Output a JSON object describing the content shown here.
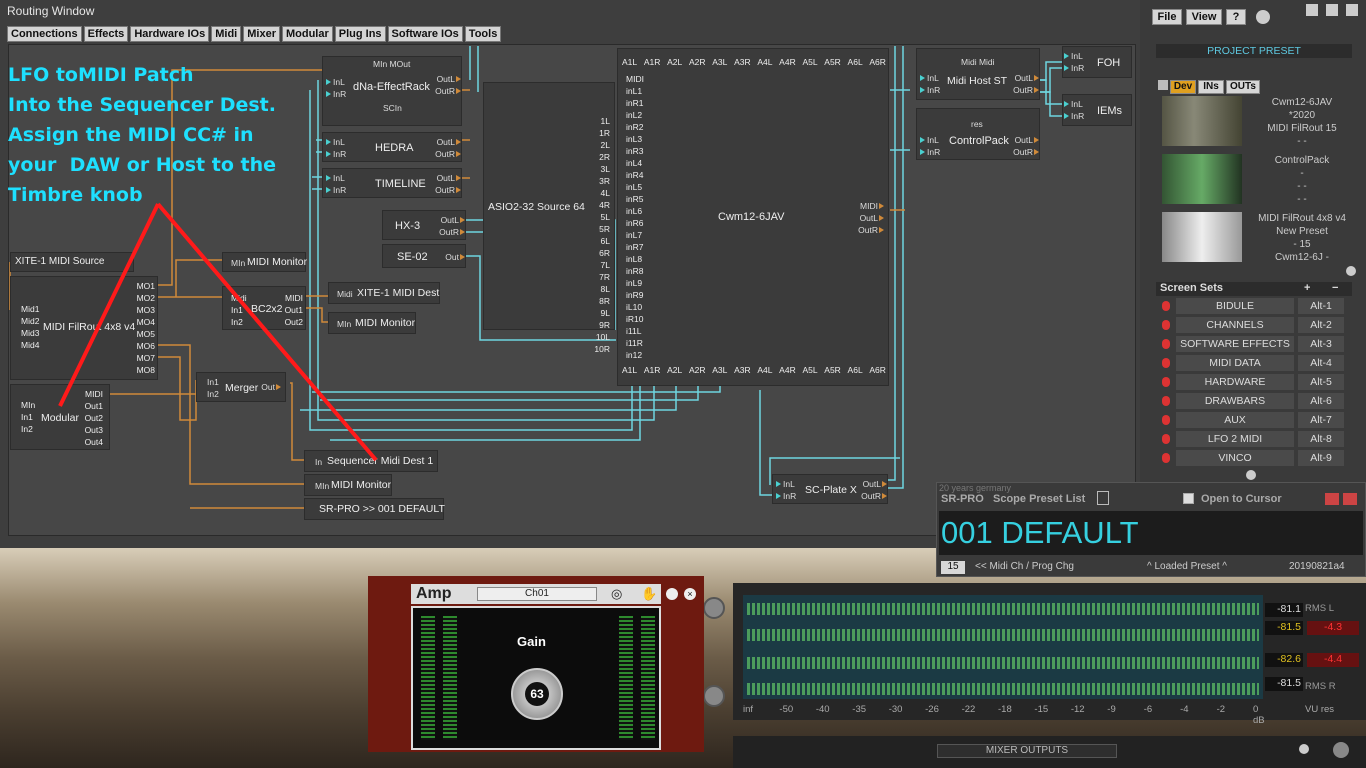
{
  "window": {
    "title": "Routing Window"
  },
  "menu": [
    "Connections",
    "Effects",
    "Hardware IOs",
    "Midi",
    "Mixer",
    "Modular",
    "Plug Ins",
    "Software IOs",
    "Tools"
  ],
  "note": "LFO toMIDI Patch\nInto the Sequencer Dest.\nAssign the MIDI CC# in\nyour  DAW or Host to the\nTimbre knob",
  "modules": {
    "dna": {
      "name": "dNa-EffectRack",
      "top": "MIn MOut",
      "inL": "InL",
      "inR": "InR",
      "outL": "OutL",
      "outR": "OutR",
      "scin": "SCIn"
    },
    "hedra": {
      "name": "HEDRA",
      "inL": "InL",
      "inR": "InR",
      "outL": "OutL",
      "outR": "OutR"
    },
    "timeline": {
      "name": "TIMELINE",
      "inL": "InL",
      "inR": "InR",
      "outL": "OutL",
      "outR": "OutR"
    },
    "hx3": {
      "name": "HX-3",
      "outL": "OutL",
      "outR": "OutR"
    },
    "se02": {
      "name": "SE-02",
      "out": "Out"
    },
    "asio": {
      "name": "ASIO2-32 Source 64",
      "outs": [
        "1L",
        "1R",
        "2L",
        "2R",
        "3L",
        "3R",
        "4L",
        "4R",
        "5L",
        "5R",
        "6L",
        "6R",
        "7L",
        "7R",
        "8L",
        "8R",
        "9L",
        "9R",
        "10L",
        "10R"
      ]
    },
    "cwm": {
      "name": "Cwm12-6JAV",
      "top": [
        "A1L",
        "A1R",
        "A2L",
        "A2R",
        "A3L",
        "A3R",
        "A4L",
        "A4R",
        "A5L",
        "A5R",
        "A6L",
        "A6R"
      ],
      "ins": [
        "MIDI",
        "inL1",
        "inR1",
        "inL2",
        "inR2",
        "inL3",
        "inR3",
        "inL4",
        "inR4",
        "inL5",
        "inR5",
        "inL6",
        "inR6",
        "inL7",
        "inR7",
        "inL8",
        "inR8",
        "inL9",
        "inR9",
        "iL10",
        "iR10",
        "i11L",
        "i11R",
        "in12"
      ],
      "outs": [
        "MIDI",
        "OutL",
        "OutR"
      ]
    },
    "hostst": {
      "name": "Midi Host ST",
      "top": "Midi  Midi",
      "inL": "InL",
      "inR": "InR",
      "outL": "OutL",
      "outR": "OutR"
    },
    "foh": {
      "name": "FOH",
      "inL": "InL",
      "inR": "InR"
    },
    "iems": {
      "name": "IEMs",
      "inL": "InL",
      "inR": "InR"
    },
    "controlpack": {
      "name": "ControlPack",
      "top": "res",
      "inL": "InL",
      "inR": "InR",
      "outL": "OutL",
      "outR": "OutR"
    },
    "xite_src": {
      "name": "XITE-1 MIDI Source"
    },
    "filrout": {
      "name": "MIDI FilRout 4x8 v4",
      "ins": [
        "Mid1",
        "Mid2",
        "Mid3",
        "Mid4"
      ],
      "outs": [
        "MO1",
        "MO2",
        "MO3",
        "MO4",
        "MO5",
        "MO6",
        "MO7",
        "MO8"
      ]
    },
    "modular": {
      "name": "Modular",
      "ins": [
        "MIn",
        "In1",
        "In2"
      ],
      "outs": [
        "MIDI",
        "Out1",
        "Out2",
        "Out3",
        "Out4"
      ]
    },
    "midimon1": {
      "name": "MIDI Monitor",
      "in": "MIn"
    },
    "bc2x2": {
      "name": "BC2x2",
      "ins": [
        "Midi",
        "In1",
        "In2"
      ],
      "outs": [
        "MIDI",
        "Out1",
        "Out2"
      ]
    },
    "xite_dest": {
      "name": "XITE-1 MIDI Dest",
      "in": "Midi"
    },
    "midimon2": {
      "name": "MIDI Monitor",
      "in": "MIn"
    },
    "merger": {
      "name": "Merger",
      "ins": [
        "In1",
        "In2"
      ],
      "out": "Out"
    },
    "seqdest": {
      "name": "Sequencer Midi Dest 1",
      "in": "In"
    },
    "midimon3": {
      "name": "MIDI Monitor",
      "in": "MIn"
    },
    "srpro_mod": {
      "name": "SR-PRO >> 001 DEFAULT"
    },
    "scplate": {
      "name": "SC-Plate X",
      "inL": "InL",
      "inR": "InR",
      "outL": "OutL",
      "outR": "OutR"
    }
  },
  "right_panel": {
    "file": "File",
    "view": "View",
    "help": "?",
    "project_preset": "PROJECT PRESET",
    "tabs": [
      "Dev",
      "INs",
      "OUTs"
    ],
    "devices": [
      {
        "lines": [
          "Cwm12-6JAV",
          "*2020",
          "MIDI FilRout   15",
          "-       -"
        ]
      },
      {
        "lines": [
          "ControlPack",
          "-",
          "-       -",
          "-       -"
        ]
      },
      {
        "lines": [
          "MIDI FilRout 4x8 v4",
          "New Preset",
          "-      15",
          "Cwm12-6J  -"
        ]
      }
    ],
    "screen_sets_title": "Screen Sets",
    "screen_sets": [
      {
        "name": "BIDULE",
        "key": "Alt-1"
      },
      {
        "name": "CHANNELS",
        "key": "Alt-2"
      },
      {
        "name": "SOFTWARE EFFECTS",
        "key": "Alt-3"
      },
      {
        "name": "MIDI DATA",
        "key": "Alt-4"
      },
      {
        "name": "HARDWARE",
        "key": "Alt-5"
      },
      {
        "name": "DRAWBARS",
        "key": "Alt-6"
      },
      {
        "name": "AUX",
        "key": "Alt-7"
      },
      {
        "name": "LFO 2 MIDI",
        "key": "Alt-8"
      },
      {
        "name": "VINCO",
        "key": "Alt-9"
      }
    ]
  },
  "srpro": {
    "brand": "20 years germany",
    "title": "SR-PRO",
    "list": "Scope Preset List",
    "open": "Open to Cursor",
    "preset": "001 DEFAULT",
    "ch": "15",
    "midi": "<< Midi Ch / Prog Chg",
    "loaded": "^ Loaded Preset ^",
    "date": "20190821a4"
  },
  "amp": {
    "title": "Amp",
    "channel": "Ch01",
    "gain_label": "Gain",
    "gain_value": "63"
  },
  "meter": {
    "l1": "-81.1",
    "l2": "-81.5",
    "r1": "-4.3",
    "l3": "-82.6",
    "r2": "-4.4",
    "l4": "-81.5",
    "rmsl": "RMS L",
    "rmsr": "RMS R",
    "scale": [
      "inf",
      "-50",
      "-40",
      "-35",
      "-30",
      "-26",
      "-22",
      "-18",
      "-15",
      "-12",
      "-9",
      "-6",
      "-4",
      "-2",
      "0 dB"
    ],
    "vu": "VU res"
  },
  "bottom": {
    "label": "MIXER OUTPUTS"
  },
  "colors": {
    "note": "#1ee0ff",
    "wire_orange": "#d08a3a",
    "wire_cyan": "#6fd6e0",
    "arrow": "#ff1a1a"
  }
}
